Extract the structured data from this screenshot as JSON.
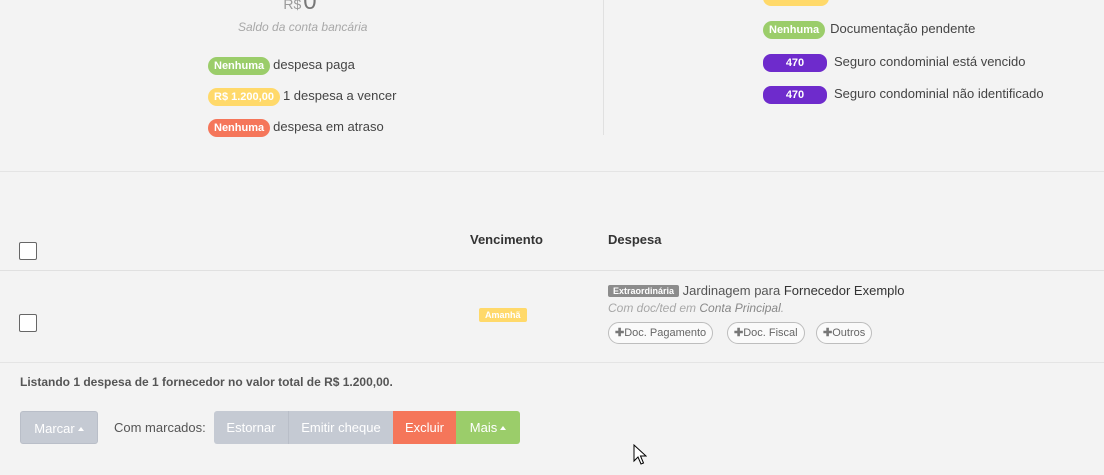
{
  "summary_panel": {
    "balance": {
      "currency": "R$",
      "amount": "0",
      "caption": "Saldo da conta bancária"
    },
    "left_stats": [
      {
        "badge": "Nenhuma",
        "badge_color": "#9bcd6a",
        "text": "despesa paga"
      },
      {
        "badge": "R$ 1.200,00",
        "badge_color": "#ffd96a",
        "text": "1 despesa a vencer"
      },
      {
        "badge": "Nenhuma",
        "badge_color": "#f5765a",
        "text": "despesa em atraso"
      }
    ],
    "right_stats": [
      {
        "badge": "Nenhuma",
        "badge_color": "#9bcd6a",
        "text": "Documentação pendente"
      },
      {
        "badge": "470",
        "badge_color": "#6e2bcc",
        "text": "Seguro condominial está vencido"
      },
      {
        "badge": "470",
        "badge_color": "#6e2bcc",
        "text": "Seguro condominial não identificado"
      }
    ]
  },
  "table": {
    "columns": {
      "due": "Vencimento",
      "expense": "Despesa"
    },
    "rows": [
      {
        "due_badge": "Amanhã",
        "type_badge": "Extraordinária",
        "description": "Jardinagem para",
        "supplier": "Fornecedor Exemplo",
        "payment_prefix": "Com doc/ted em",
        "account": "Conta Principal",
        "payment_suffix": ".",
        "doc_buttons": [
          "Doc. Pagamento",
          "Doc. Fiscal",
          "Outros"
        ]
      }
    ]
  },
  "listing_summary": "Listando 1 despesa de 1 fornecedor no valor total de R$ 1.200,00.",
  "actions": {
    "mark": "Marcar",
    "with_marked": "Com marcados:",
    "reverse": "Estornar",
    "issue_check": "Emitir cheque",
    "delete": "Excluir",
    "more": "Mais"
  },
  "colors": {
    "green": "#9bcd6a",
    "yellow": "#ffd96a",
    "orange": "#f5765a",
    "purple": "#6e2bcc",
    "gray_button": "#c5cad3"
  }
}
